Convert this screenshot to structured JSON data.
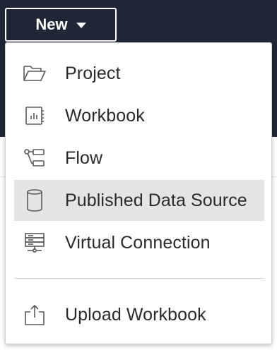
{
  "new_button": {
    "label": "New",
    "icon": "caret-down-icon"
  },
  "menu": {
    "items": [
      {
        "label": "Project",
        "icon": "folder-open-icon"
      },
      {
        "label": "Workbook",
        "icon": "workbook-icon"
      },
      {
        "label": "Flow",
        "icon": "flow-icon"
      },
      {
        "label": "Published Data Source",
        "icon": "database-cylinder-icon",
        "selected": true
      },
      {
        "label": "Virtual Connection",
        "icon": "virtual-connection-icon"
      }
    ],
    "upload": {
      "label": "Upload Workbook",
      "icon": "upload-icon"
    }
  },
  "colors": {
    "header_background": "#1f2635",
    "highlight": "#e4e4e4",
    "icon_stroke": "#5a5a5a",
    "text": "#2a2a2a"
  }
}
